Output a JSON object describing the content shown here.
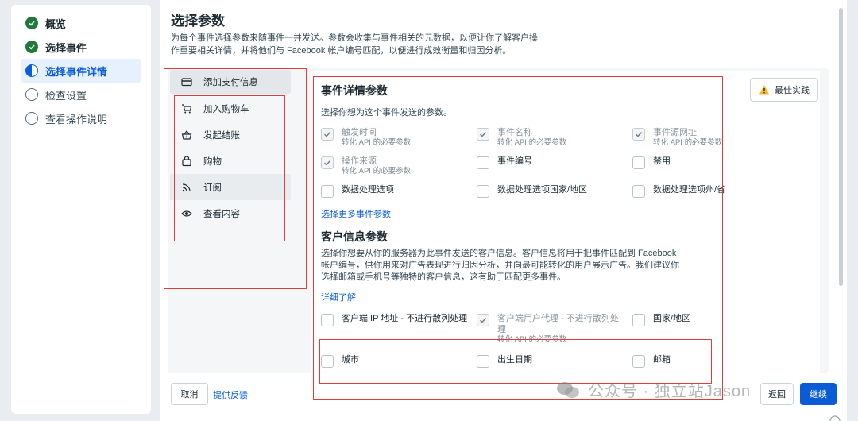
{
  "stepper": {
    "steps": [
      {
        "label": "概览",
        "state": "done"
      },
      {
        "label": "选择事件",
        "state": "done"
      },
      {
        "label": "选择事件详情",
        "state": "active"
      },
      {
        "label": "检查设置",
        "state": "pending"
      },
      {
        "label": "查看操作说明",
        "state": "pending"
      }
    ]
  },
  "header": {
    "title": "选择参数",
    "description": "为每个事件选择参数来随事件一并发送。参数会收集与事件相关的元数据，以便让你了解客户操作重要相关详情，并将他们与 Facebook 帐户编号匹配，以便进行成效衡量和归因分析。"
  },
  "best_practice_label": "最佳实践",
  "events": [
    {
      "label": "添加支付信息",
      "icon": "credit-card-icon"
    },
    {
      "label": "加入购物车",
      "icon": "cart-icon"
    },
    {
      "label": "发起结账",
      "icon": "basket-icon"
    },
    {
      "label": "购物",
      "icon": "shopping-bag-icon"
    },
    {
      "label": "订阅",
      "icon": "rss-icon"
    },
    {
      "label": "查看内容",
      "icon": "eye-icon"
    }
  ],
  "event_details": {
    "title": "事件详情参数",
    "description": "选择你想为这个事件发送的参数。",
    "params": [
      {
        "label": "触发时间",
        "sub": "转化 API 的必要参数",
        "checked": true
      },
      {
        "label": "事件名称",
        "sub": "转化 API 的必要参数",
        "checked": true
      },
      {
        "label": "事件源网址",
        "sub": "转化 API 的必要参数",
        "checked": true
      },
      {
        "label": "操作来源",
        "sub": "转化 API 的必要参数",
        "checked": true
      },
      {
        "label": "事件编号",
        "sub": "",
        "checked": false
      },
      {
        "label": "禁用",
        "sub": "",
        "checked": false
      },
      {
        "label": "数据处理选项",
        "sub": "",
        "checked": false
      },
      {
        "label": "数据处理选项国家/地区",
        "sub": "",
        "checked": false
      },
      {
        "label": "数据处理选项州/省",
        "sub": "",
        "checked": false
      }
    ],
    "more_link": "选择更多事件参数"
  },
  "customer_info": {
    "title": "客户信息参数",
    "description": "选择你想要从你的服务器为此事件发送的客户信息。客户信息将用于把事件匹配到 Facebook 帐户编号，供你用来对广告表现进行归因分析，并向最可能转化的用户展示广告。我们建议你选择邮箱或手机号等独特的客户信息，这有助于匹配更多事件。",
    "learn_more": "详细了解",
    "params": [
      {
        "label": "客户端 IP 地址 - 不进行散列处理",
        "sub": "",
        "checked": false
      },
      {
        "label": "客户端用户代理 - 不进行散列处理",
        "sub": "转化 API 的必要参数",
        "checked": true
      },
      {
        "label": "国家/地区",
        "sub": "",
        "checked": false
      },
      {
        "label": "城市",
        "sub": "",
        "checked": false
      },
      {
        "label": "出生日期",
        "sub": "",
        "checked": false
      },
      {
        "label": "邮箱",
        "sub": "",
        "checked": false
      }
    ]
  },
  "footer": {
    "cancel": "取消",
    "feedback": "提供反馈",
    "back": "返回",
    "continue": "继续"
  },
  "watermark": "公众号 · 独立站Jason",
  "colors": {
    "accent": "#0a5cd6",
    "done": "#1f7a3a",
    "annotation": "#e03c3c",
    "warning": "#f7b928"
  }
}
